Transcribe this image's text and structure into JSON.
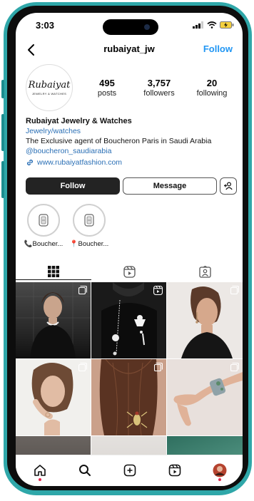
{
  "status": {
    "time": "3:03"
  },
  "header": {
    "username": "rubaiyat_jw",
    "follow_link": "Follow"
  },
  "avatar": {
    "logo": "Rubaiyat",
    "sub": "JEWELRY & WATCHES"
  },
  "stats": [
    {
      "value": "495",
      "label": "posts"
    },
    {
      "value": "3,757",
      "label": "followers"
    },
    {
      "value": "20",
      "label": "following"
    }
  ],
  "bio": {
    "name": "Rubaiyat Jewelry & Watches",
    "category": "Jewelry/watches",
    "description": "The Exclusive agent of Boucheron Paris in Saudi Arabia",
    "mention": "@boucheron_saudiarabia",
    "website": "www.rubaiyatfashion.com"
  },
  "buttons": {
    "follow": "Follow",
    "message": "Message"
  },
  "highlights": [
    {
      "label": "📞Boucher...",
      "icon": "boucheron-store-icon"
    },
    {
      "label": "📍Boucher...",
      "icon": "boucheron-store-icon"
    }
  ],
  "tabs": [
    {
      "name": "grid",
      "icon": "grid-icon",
      "active": true
    },
    {
      "name": "reels",
      "icon": "reels-icon",
      "active": false
    },
    {
      "name": "tagged",
      "icon": "tagged-icon",
      "active": false
    }
  ],
  "posts": [
    {
      "desc": "model-black-outfit-necklace",
      "overlay": "multiple-icon",
      "bg": "#3a3a3a",
      "accent": "#cfcfcf"
    },
    {
      "desc": "black-sweater-brooches",
      "overlay": "reel-icon",
      "bg": "#1d1d1d",
      "accent": "#e6e6e6"
    },
    {
      "desc": "model-earrings-portrait",
      "overlay": "multiple-icon",
      "bg": "#eae6e3",
      "accent": "#b8926c"
    },
    {
      "desc": "model-face-ring",
      "overlay": "multiple-icon",
      "bg": "#f0efec",
      "accent": "#c9a487"
    },
    {
      "desc": "hair-pin-insect",
      "overlay": "multiple-icon",
      "bg": "#c9a08a",
      "accent": "#6b3f2a"
    },
    {
      "desc": "hand-serpent-bracelet",
      "overlay": "multiple-icon",
      "bg": "#e7dfdb",
      "accent": "#8fa2a8"
    },
    {
      "desc": "partial-bottom-1",
      "overlay": "",
      "bg": "#5d5a57",
      "accent": "#333"
    },
    {
      "desc": "partial-bottom-2",
      "overlay": "",
      "bg": "#d8d5d2",
      "accent": "#aaa"
    },
    {
      "desc": "partial-bottom-3",
      "overlay": "",
      "bg": "#3c7a6a",
      "accent": "#9fd0c0"
    }
  ],
  "nav": [
    {
      "name": "home",
      "icon": "home-icon"
    },
    {
      "name": "search",
      "icon": "search-icon"
    },
    {
      "name": "create",
      "icon": "create-icon"
    },
    {
      "name": "reels",
      "icon": "reels-icon"
    },
    {
      "name": "profile",
      "icon": "profile-avatar-icon"
    }
  ],
  "colors": {
    "frame": "#2fa7a9",
    "link": "#2a6fb5",
    "follow_link": "#2196f3",
    "follow_button": "#232323"
  }
}
